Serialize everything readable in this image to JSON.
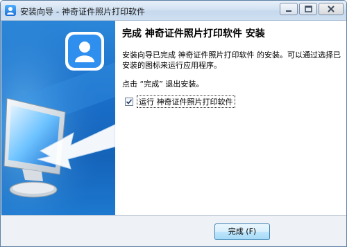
{
  "window": {
    "title": "安装向导 - 神奇证件照片打印软件",
    "controls": {
      "minimize": "minimize-icon",
      "maximize": "maximize-icon",
      "close": "close-icon"
    }
  },
  "sidebar": {
    "illustration": "monitor-with-arrow",
    "app_icon": "user-avatar-icon"
  },
  "main": {
    "heading": "完成 神奇证件照片打印软件 安装",
    "description": "安装向导已完成 神奇证件照片打印软件 的安装。可以通过选择已安装的图标来运行应用程序。",
    "instruction": "点击 “完成” 退出安装。",
    "run_checkbox": {
      "label": "运行 神奇证件照片打印软件",
      "checked": true
    }
  },
  "footer": {
    "finish_label": "完成 (F)"
  },
  "colors": {
    "sidebar_blue": "#1a6ec8",
    "title_gradient": "#d3e2f2",
    "button_blue": "#3c7fb1"
  }
}
